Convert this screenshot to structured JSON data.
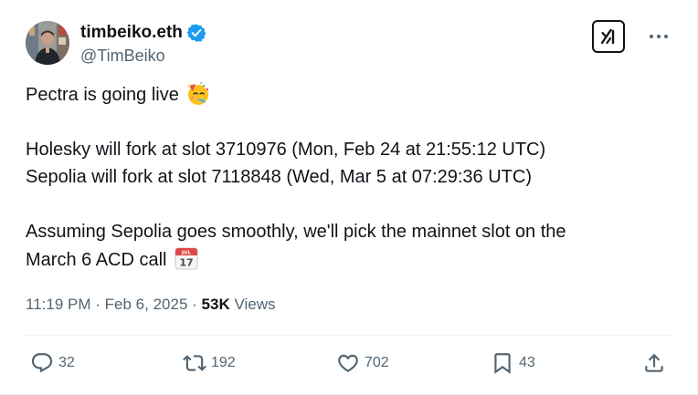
{
  "author": {
    "display_name": "timbeiko.eth",
    "handle": "@TimBeiko",
    "verified": true
  },
  "tweet": {
    "line1": "Pectra is going live",
    "line1_emoji": "partying-face-emoji",
    "line2": "Holesky will fork at slot 3710976 (Mon, Feb 24 at 21:55:12 UTC)",
    "line3": "Sepolia will fork at slot 7118848 (Wed, Mar 5 at 07:29:36 UTC)",
    "line4": "Assuming Sepolia goes smoothly, we'll pick the mainnet slot on the",
    "line5": "March 6 ACD call",
    "line5_emoji": "calendar-emoji",
    "calendar_emoji_month": "JUL",
    "calendar_emoji_day": "17"
  },
  "meta": {
    "time": "11:19 PM",
    "separator": "·",
    "date": "Feb 6, 2025",
    "views_count": "53K",
    "views_label": "Views"
  },
  "actions": {
    "replies": "32",
    "reposts": "192",
    "likes": "702",
    "bookmarks": "43"
  },
  "colors": {
    "text": "#0f1419",
    "secondary": "#536471",
    "verified_blue": "#1d9bf0",
    "divider": "#eff3f4"
  }
}
